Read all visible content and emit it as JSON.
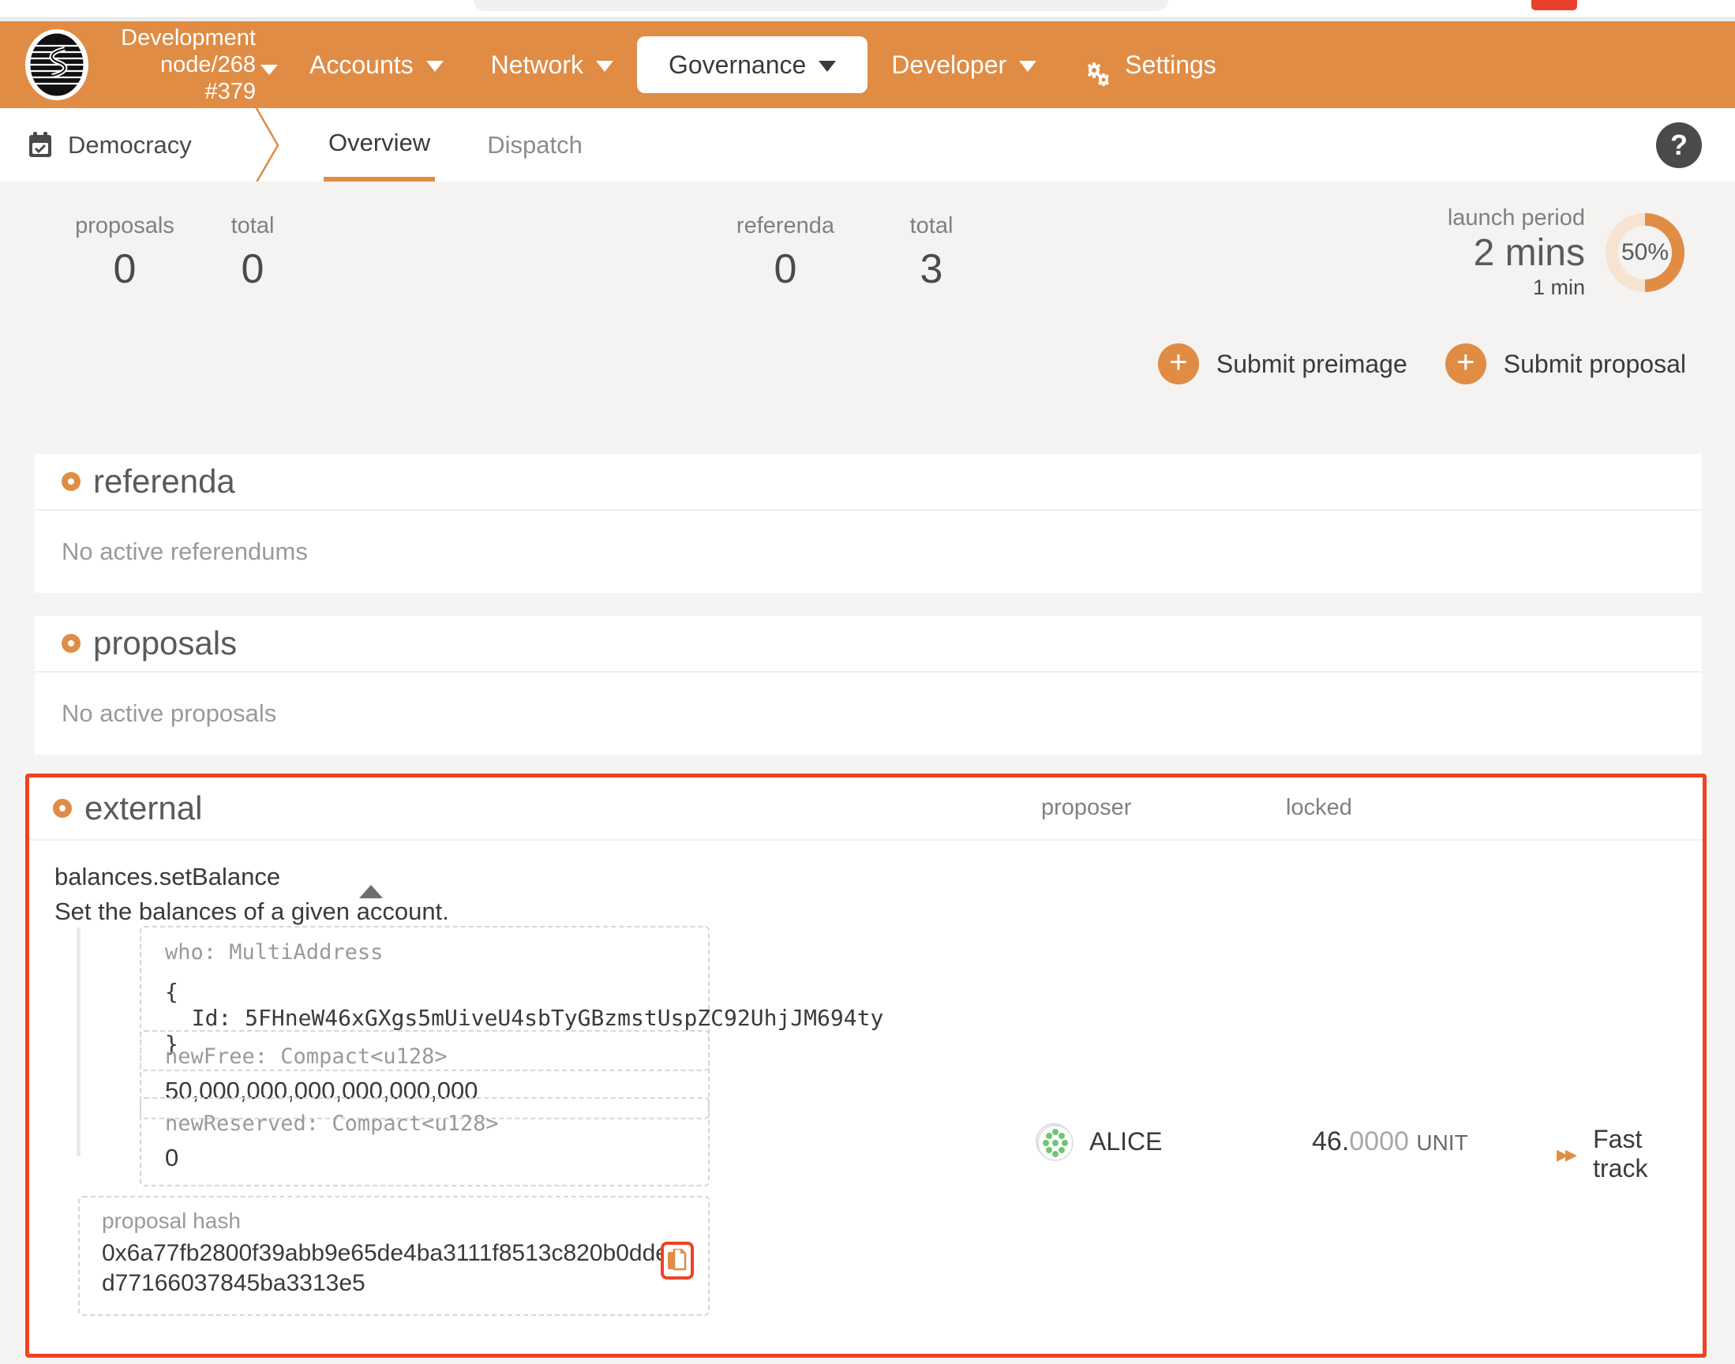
{
  "browser": {
    "accent_red": "#e8402a"
  },
  "topnav": {
    "logo_icon": "substrate-logo-icon",
    "node": {
      "line1": "Development",
      "line2": "node/268",
      "line3": "#379"
    },
    "items": [
      {
        "label": "Accounts",
        "icon": "chevron-down-icon",
        "active": false
      },
      {
        "label": "Network",
        "icon": "chevron-down-icon",
        "active": false
      },
      {
        "label": "Governance",
        "icon": "chevron-down-icon",
        "active": true
      },
      {
        "label": "Developer",
        "icon": "chevron-down-icon",
        "active": false
      }
    ],
    "settings": {
      "label": "Settings",
      "icon": "gear-icon"
    },
    "bg_color": "#e08c45"
  },
  "subbar": {
    "breadcrumb": {
      "label": "Democracy",
      "icon": "calendar-check-icon"
    },
    "tabs": [
      {
        "label": "Overview",
        "selected": true
      },
      {
        "label": "Dispatch",
        "selected": false
      }
    ],
    "help": {
      "label": "?"
    }
  },
  "summary": {
    "stats": [
      {
        "label": "proposals",
        "value": "0"
      },
      {
        "label": "total",
        "value": "0"
      },
      {
        "label": "referenda",
        "value": "0"
      },
      {
        "label": "total",
        "value": "3"
      }
    ],
    "launch_period": {
      "label": "launch period",
      "remaining": "2 mins",
      "elapsed": "1 min",
      "percent_label": "50%",
      "percent": 50,
      "accent": "#e08c45"
    },
    "actions": [
      {
        "label": "Submit preimage",
        "icon": "plus-icon"
      },
      {
        "label": "Submit proposal",
        "icon": "plus-icon"
      }
    ]
  },
  "referenda_card": {
    "title": "referenda",
    "bullet_icon": "orange-dot-icon",
    "empty_text": "No active referendums"
  },
  "proposals_card": {
    "title": "proposals",
    "bullet_icon": "orange-dot-icon",
    "empty_text": "No active proposals"
  },
  "external_card": {
    "title": "external",
    "bullet_icon": "orange-dot-icon",
    "columns": {
      "proposer": "proposer",
      "locked": "locked"
    },
    "highlight_color": "#ee4223",
    "call": {
      "name": "balances.setBalance",
      "description": "Set the balances of a given account.",
      "collapse_icon": "caret-up-icon",
      "params": [
        {
          "type": "who: MultiAddress",
          "value": "{\n  Id: 5FHneW46xGXgs5mUiveU4sbTyGBzmstUspZC92UhjJM694ty\n}",
          "mono": true
        },
        {
          "type": "newFree: Compact<u128>",
          "value": "50,000,000,000,000,000,000",
          "mono": false
        },
        {
          "type": "newReserved: Compact<u128>",
          "value": "0",
          "mono": false
        }
      ]
    },
    "hash": {
      "label": "proposal hash",
      "value": "0x6a77fb2800f39abb9e65de4ba3111f8513c820b0dde1d77166037845ba3313e5",
      "copy_icon": "copy-icon"
    },
    "row": {
      "proposer": "ALICE",
      "proposer_avatar": "identicon-avatar",
      "locked_int": "46.",
      "locked_frac": "0000",
      "locked_unit": "UNIT",
      "action_label": "Fast track",
      "action_icon": "fast-forward-icon"
    }
  }
}
